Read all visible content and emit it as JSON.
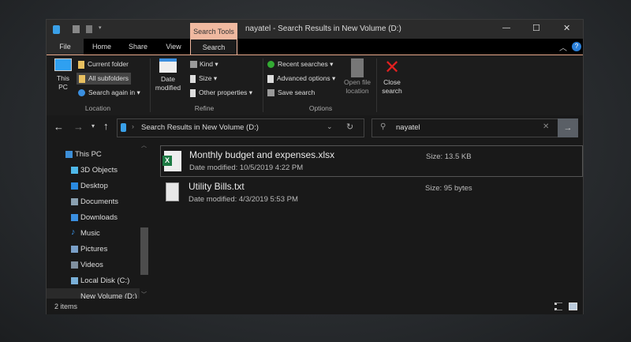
{
  "window": {
    "title": "nayatel - Search Results in New Volume (D:)",
    "context_tab": "Search Tools",
    "controls": {
      "minimize": "—",
      "maximize": "☐",
      "close": "✕"
    }
  },
  "tabs": [
    {
      "label": "File"
    },
    {
      "label": "Home"
    },
    {
      "label": "Share"
    },
    {
      "label": "View"
    },
    {
      "label": "Search",
      "active": true
    }
  ],
  "ribbon": {
    "location": {
      "group": "Location",
      "this_pc": "This PC",
      "current_folder": "Current folder",
      "all_subfolders": "All subfolders",
      "search_again": "Search again in"
    },
    "refine": {
      "group": "Refine",
      "date_modified": "Date modified",
      "kind": "Kind",
      "size": "Size",
      "other": "Other properties"
    },
    "options": {
      "group": "Options",
      "recent": "Recent searches",
      "advanced": "Advanced options",
      "save": "Save search",
      "open_location": "Open file location"
    },
    "close": {
      "label": "Close search"
    }
  },
  "nav": {
    "address": "Search Results in New Volume (D:)",
    "search_value": "nayatel"
  },
  "sidebar": {
    "items": [
      {
        "label": "This PC",
        "color": "#3d8fd8"
      },
      {
        "label": "3D Objects",
        "color": "#4fb8e8"
      },
      {
        "label": "Desktop",
        "color": "#2a8ae0"
      },
      {
        "label": "Documents",
        "color": "#8aa0b0"
      },
      {
        "label": "Downloads",
        "color": "#3a8fe0"
      },
      {
        "label": "Music",
        "color": "#3a8fe0"
      },
      {
        "label": "Pictures",
        "color": "#7aa0c8"
      },
      {
        "label": "Videos",
        "color": "#8090a0"
      },
      {
        "label": "Local Disk (C:)",
        "color": "#7ab0d8"
      },
      {
        "label": "New Volume (D:)",
        "color": "#cccccc"
      }
    ]
  },
  "results": [
    {
      "name": "Monthly budget and expenses.xlsx",
      "date": "Date modified: 10/5/2019 4:22 PM",
      "size": "Size: 13.5 KB",
      "icon": "excel-icon"
    },
    {
      "name": "Utility Bills.txt",
      "date": "Date modified: 4/3/2019 5:53 PM",
      "size": "Size: 95 bytes",
      "icon": "text-file-icon"
    }
  ],
  "status": {
    "count": "2 items"
  },
  "colors": {
    "accent": "#f0b9a0",
    "close_red": "#e02020"
  }
}
